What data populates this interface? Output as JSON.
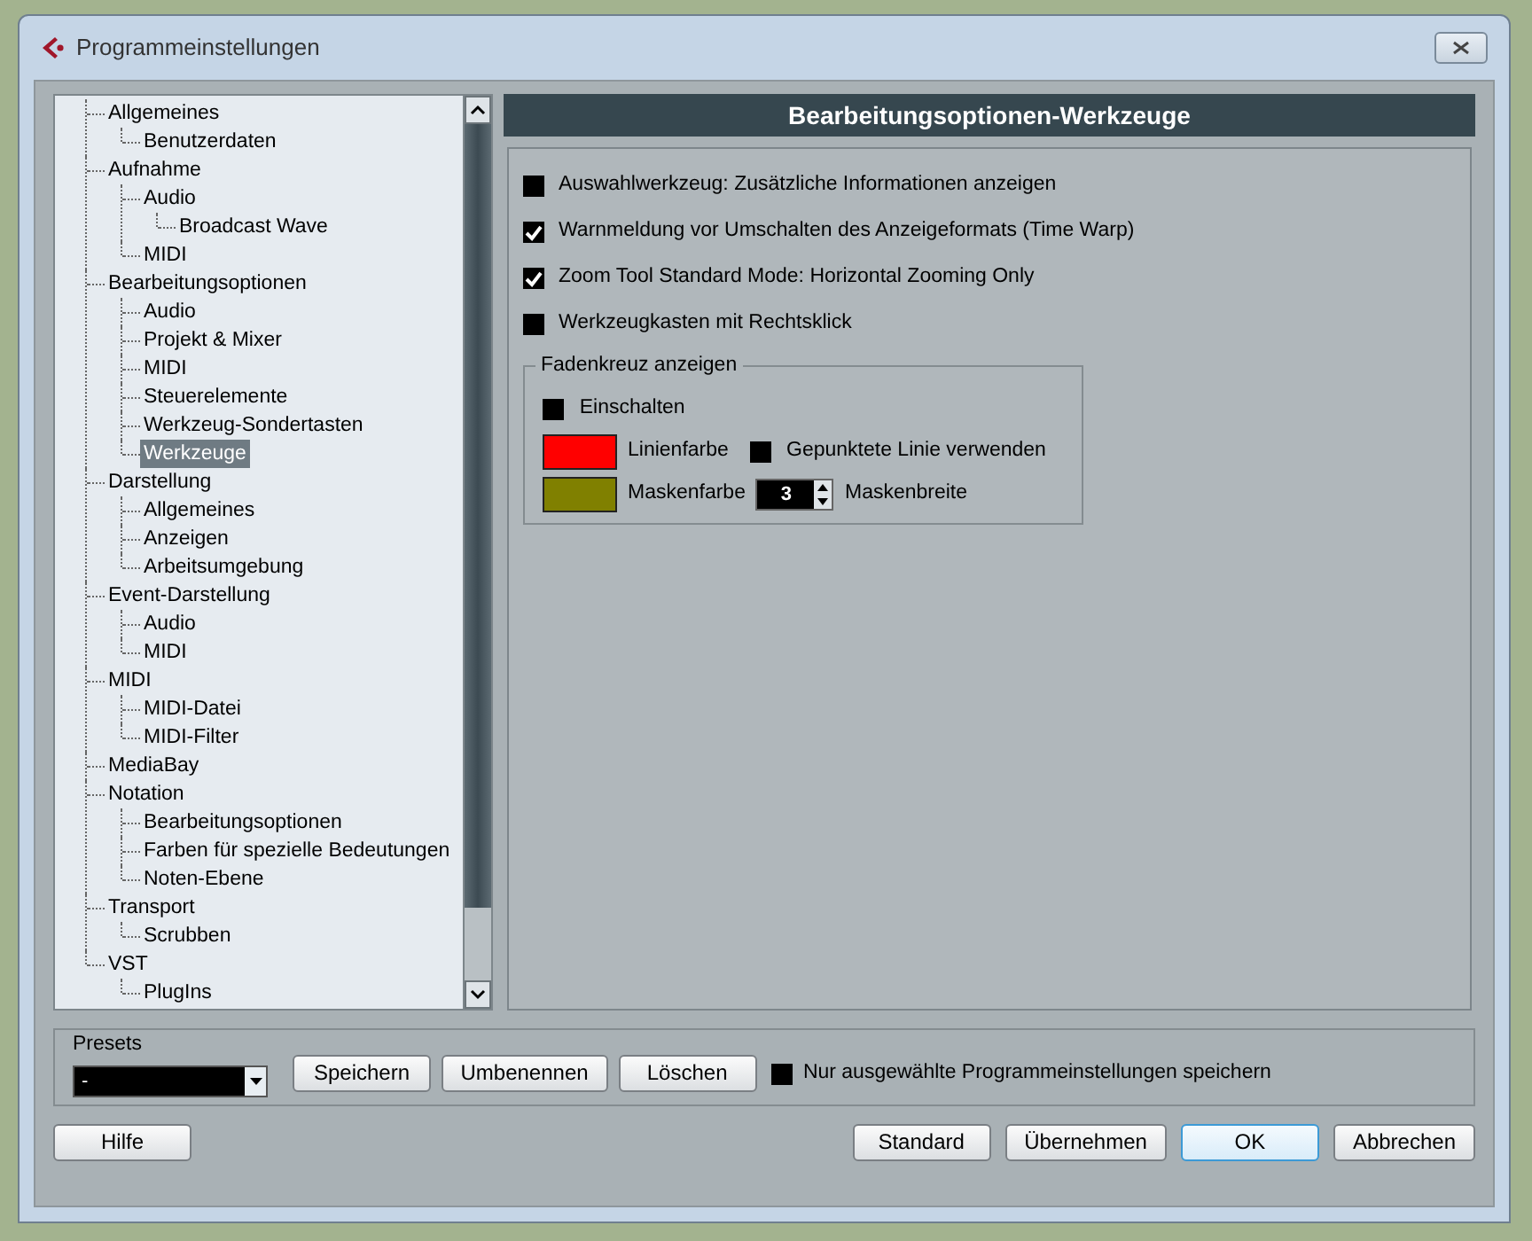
{
  "window": {
    "title": "Programmeinstellungen"
  },
  "tree": [
    {
      "label": "Allgemeines",
      "selected": false,
      "children": [
        {
          "label": "Benutzerdaten",
          "selected": false
        }
      ]
    },
    {
      "label": "Aufnahme",
      "selected": false,
      "children": [
        {
          "label": "Audio",
          "selected": false,
          "children": [
            {
              "label": "Broadcast Wave",
              "selected": false
            }
          ]
        },
        {
          "label": "MIDI",
          "selected": false
        }
      ]
    },
    {
      "label": "Bearbeitungsoptionen",
      "selected": false,
      "children": [
        {
          "label": "Audio",
          "selected": false
        },
        {
          "label": "Projekt & Mixer",
          "selected": false
        },
        {
          "label": "MIDI",
          "selected": false
        },
        {
          "label": "Steuerelemente",
          "selected": false
        },
        {
          "label": "Werkzeug-Sondertasten",
          "selected": false
        },
        {
          "label": "Werkzeuge",
          "selected": true
        }
      ]
    },
    {
      "label": "Darstellung",
      "selected": false,
      "children": [
        {
          "label": "Allgemeines",
          "selected": false
        },
        {
          "label": "Anzeigen",
          "selected": false
        },
        {
          "label": "Arbeitsumgebung",
          "selected": false
        }
      ]
    },
    {
      "label": "Event-Darstellung",
      "selected": false,
      "children": [
        {
          "label": "Audio",
          "selected": false
        },
        {
          "label": "MIDI",
          "selected": false
        }
      ]
    },
    {
      "label": "MIDI",
      "selected": false,
      "children": [
        {
          "label": "MIDI-Datei",
          "selected": false
        },
        {
          "label": "MIDI-Filter",
          "selected": false
        }
      ]
    },
    {
      "label": "MediaBay",
      "selected": false
    },
    {
      "label": "Notation",
      "selected": false,
      "children": [
        {
          "label": "Bearbeitungsoptionen",
          "selected": false
        },
        {
          "label": "Farben für spezielle Bedeutungen",
          "selected": false
        },
        {
          "label": "Noten-Ebene",
          "selected": false
        }
      ]
    },
    {
      "label": "Transport",
      "selected": false,
      "children": [
        {
          "label": "Scrubben",
          "selected": false
        }
      ]
    },
    {
      "label": "VST",
      "selected": false,
      "children": [
        {
          "label": "PlugIns",
          "selected": false
        }
      ]
    }
  ],
  "panel": {
    "title": "Bearbeitungsoptionen-Werkzeuge",
    "options": [
      {
        "label": "Auswahlwerkzeug: Zusätzliche Informationen anzeigen",
        "checked": false
      },
      {
        "label": "Warnmeldung vor Umschalten des Anzeigeformats (Time Warp)",
        "checked": true
      },
      {
        "label": "Zoom Tool Standard Mode: Horizontal Zooming Only",
        "checked": true
      },
      {
        "label": "Werkzeugkasten mit Rechtsklick",
        "checked": false
      }
    ],
    "crosshair": {
      "title": "Fadenkreuz anzeigen",
      "enable": {
        "label": "Einschalten",
        "checked": false
      },
      "line_color": {
        "label": "Linienfarbe",
        "color": "#ff0000"
      },
      "dotted_line": {
        "label": "Gepunktete Linie verwenden",
        "checked": false
      },
      "mask_color": {
        "label": "Maskenfarbe",
        "color": "#808000"
      },
      "mask_width": {
        "value": "3",
        "label": "Maskenbreite"
      }
    }
  },
  "presets": {
    "label": "Presets",
    "value": "-",
    "buttons": [
      "Speichern",
      "Umbenennen",
      "Löschen"
    ],
    "save_selected": {
      "label": "Nur ausgewählte Programmeinstellungen speichern",
      "checked": false
    }
  },
  "footer": {
    "left": [
      {
        "label": "Hilfe",
        "default": false
      }
    ],
    "right": [
      {
        "label": "Standard",
        "default": false
      },
      {
        "label": "Übernehmen",
        "default": false
      },
      {
        "label": "OK",
        "default": true
      },
      {
        "label": "Abbrechen",
        "default": false
      }
    ]
  }
}
